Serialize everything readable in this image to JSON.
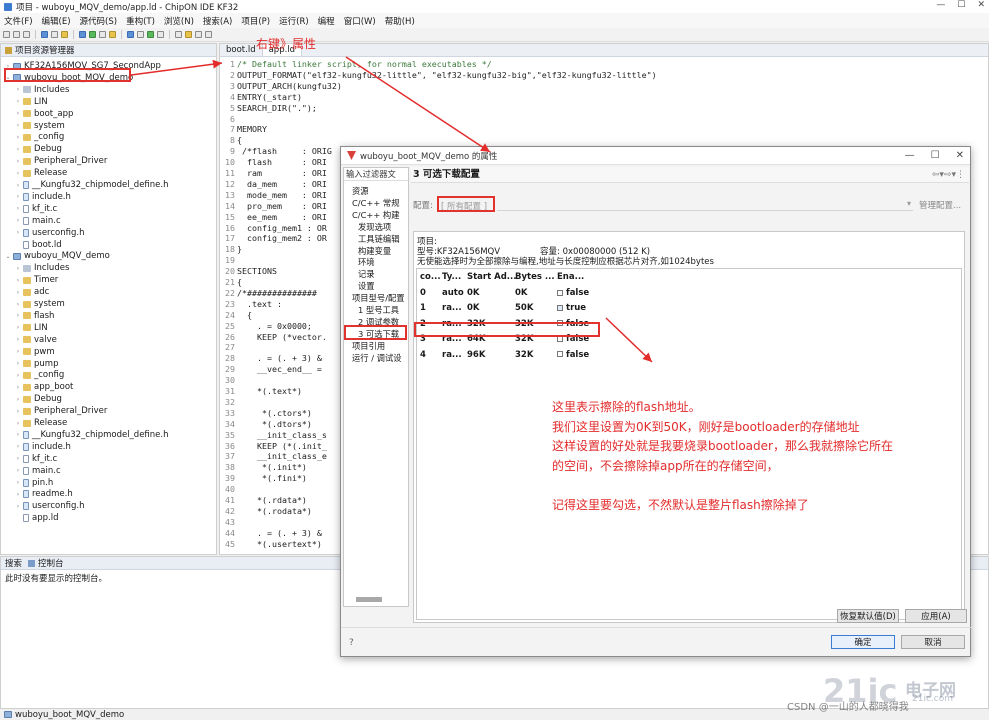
{
  "window": {
    "title": "项目 - wuboyu_MQV_demo/app.ld - ChipON IDE KF32",
    "min": "—",
    "max": "☐",
    "close": "✕"
  },
  "menu": [
    "文件(F)",
    "编辑(E)",
    "源代码(S)",
    "重构(T)",
    "浏览(N)",
    "搜索(A)",
    "项目(P)",
    "运行(R)",
    "编程",
    "窗口(W)",
    "帮助(H)"
  ],
  "explorer": {
    "title": "项目资源管理器",
    "rows": [
      {
        "label": "KF32A156MQV_SG7_SecondApp",
        "indent": 0,
        "type": "proj",
        "tri": "›"
      },
      {
        "label": "wuboyu_boot_MQV_demo",
        "indent": 0,
        "type": "proj",
        "tri": "⌄"
      },
      {
        "label": "Includes",
        "indent": 1,
        "type": "lib",
        "tri": "›"
      },
      {
        "label": "LIN",
        "indent": 1,
        "type": "folder",
        "tri": "›"
      },
      {
        "label": "boot_app",
        "indent": 1,
        "type": "folder",
        "tri": "›"
      },
      {
        "label": "system",
        "indent": 1,
        "type": "folder",
        "tri": "›"
      },
      {
        "label": "_config",
        "indent": 1,
        "type": "folder",
        "tri": "›"
      },
      {
        "label": "Debug",
        "indent": 1,
        "type": "folder",
        "tri": "›"
      },
      {
        "label": "Peripheral_Driver",
        "indent": 1,
        "type": "folder",
        "tri": "›"
      },
      {
        "label": "Release",
        "indent": 1,
        "type": "folder",
        "tri": "›"
      },
      {
        "label": "__Kungfu32_chipmodel_define.h",
        "indent": 1,
        "type": "hfile",
        "tri": "›"
      },
      {
        "label": "include.h",
        "indent": 1,
        "type": "hfile",
        "tri": "›"
      },
      {
        "label": "kf_it.c",
        "indent": 1,
        "type": "file",
        "tri": "›"
      },
      {
        "label": "main.c",
        "indent": 1,
        "type": "file",
        "tri": "›"
      },
      {
        "label": "userconfig.h",
        "indent": 1,
        "type": "hfile",
        "tri": "›"
      },
      {
        "label": "boot.ld",
        "indent": 1,
        "type": "file",
        "tri": ""
      },
      {
        "label": "wuboyu_MQV_demo",
        "indent": 0,
        "type": "proj",
        "tri": "⌄"
      },
      {
        "label": "Includes",
        "indent": 1,
        "type": "lib",
        "tri": "›"
      },
      {
        "label": "Timer",
        "indent": 1,
        "type": "folder",
        "tri": "›"
      },
      {
        "label": "adc",
        "indent": 1,
        "type": "folder",
        "tri": "›"
      },
      {
        "label": "system",
        "indent": 1,
        "type": "folder",
        "tri": "›"
      },
      {
        "label": "flash",
        "indent": 1,
        "type": "folder",
        "tri": "›"
      },
      {
        "label": "LIN",
        "indent": 1,
        "type": "folder",
        "tri": "›"
      },
      {
        "label": "valve",
        "indent": 1,
        "type": "folder",
        "tri": "›"
      },
      {
        "label": "pwm",
        "indent": 1,
        "type": "folder",
        "tri": "›"
      },
      {
        "label": "pump",
        "indent": 1,
        "type": "folder",
        "tri": "›"
      },
      {
        "label": "_config",
        "indent": 1,
        "type": "folder",
        "tri": "›"
      },
      {
        "label": "app_boot",
        "indent": 1,
        "type": "folder",
        "tri": "›"
      },
      {
        "label": "Debug",
        "indent": 1,
        "type": "folder",
        "tri": "›"
      },
      {
        "label": "Peripheral_Driver",
        "indent": 1,
        "type": "folder",
        "tri": "›"
      },
      {
        "label": "Release",
        "indent": 1,
        "type": "folder",
        "tri": "›"
      },
      {
        "label": "__Kungfu32_chipmodel_define.h",
        "indent": 1,
        "type": "hfile",
        "tri": "›"
      },
      {
        "label": "include.h",
        "indent": 1,
        "type": "hfile",
        "tri": "›"
      },
      {
        "label": "kf_it.c",
        "indent": 1,
        "type": "file",
        "tri": "›"
      },
      {
        "label": "main.c",
        "indent": 1,
        "type": "file",
        "tri": "›"
      },
      {
        "label": "pin.h",
        "indent": 1,
        "type": "hfile",
        "tri": "›"
      },
      {
        "label": "readme.h",
        "indent": 1,
        "type": "hfile",
        "tri": "›"
      },
      {
        "label": "userconfig.h",
        "indent": 1,
        "type": "hfile",
        "tri": "›"
      },
      {
        "label": "app.ld",
        "indent": 1,
        "type": "file",
        "tri": ""
      }
    ]
  },
  "editor": {
    "tabs": [
      "boot.ld",
      "app.ld"
    ],
    "lines": [
      {
        "n": "1",
        "t": "/* Default linker script, for normal executables */",
        "c": "cmt"
      },
      {
        "n": "2",
        "t": "OUTPUT_FORMAT(\"elf32-kungfu32-little\", \"elf32-kungfu32-big\",\"elf32-kungfu32-little\")",
        "c": ""
      },
      {
        "n": "3",
        "t": "OUTPUT_ARCH(kungfu32)",
        "c": ""
      },
      {
        "n": "4",
        "t": "ENTRY(_start)",
        "c": ""
      },
      {
        "n": "5",
        "t": "SEARCH_DIR(\".\");",
        "c": ""
      },
      {
        "n": "6",
        "t": "",
        "c": ""
      },
      {
        "n": "7",
        "t": "MEMORY",
        "c": ""
      },
      {
        "n": "8",
        "t": "{",
        "c": ""
      },
      {
        "n": "9",
        "t": " /*flash     : ORIG",
        "c": ""
      },
      {
        "n": "10",
        "t": "  flash      : ORI",
        "c": ""
      },
      {
        "n": "11",
        "t": "  ram        : ORI",
        "c": ""
      },
      {
        "n": "12",
        "t": "  da_mem     : ORI",
        "c": ""
      },
      {
        "n": "13",
        "t": "  mode_mem   : ORI",
        "c": ""
      },
      {
        "n": "14",
        "t": "  pro_mem    : ORI",
        "c": ""
      },
      {
        "n": "15",
        "t": "  ee_mem     : ORI",
        "c": ""
      },
      {
        "n": "16",
        "t": "  config_mem1 : OR",
        "c": ""
      },
      {
        "n": "17",
        "t": "  config_mem2 : OR",
        "c": ""
      },
      {
        "n": "18",
        "t": "}",
        "c": ""
      },
      {
        "n": "19",
        "t": "",
        "c": ""
      },
      {
        "n": "20",
        "t": "SECTIONS",
        "c": ""
      },
      {
        "n": "21",
        "t": "{",
        "c": ""
      },
      {
        "n": "22",
        "t": "/*##############",
        "c": ""
      },
      {
        "n": "23",
        "t": "  .text :",
        "c": ""
      },
      {
        "n": "24",
        "t": "  {",
        "c": ""
      },
      {
        "n": "25",
        "t": "    . = 0x0000;",
        "c": ""
      },
      {
        "n": "26",
        "t": "    KEEP (*vector.",
        "c": ""
      },
      {
        "n": "27",
        "t": "",
        "c": ""
      },
      {
        "n": "28",
        "t": "    . = (. + 3) &",
        "c": ""
      },
      {
        "n": "29",
        "t": "    __vec_end__ =",
        "c": ""
      },
      {
        "n": "30",
        "t": "",
        "c": ""
      },
      {
        "n": "31",
        "t": "    *(.text*)",
        "c": ""
      },
      {
        "n": "32",
        "t": "",
        "c": ""
      },
      {
        "n": "33",
        "t": "     *(.ctors*)",
        "c": ""
      },
      {
        "n": "34",
        "t": "     *(.dtors*)",
        "c": ""
      },
      {
        "n": "35",
        "t": "    __init_class_s",
        "c": ""
      },
      {
        "n": "36",
        "t": "    KEEP (*(.init_",
        "c": ""
      },
      {
        "n": "37",
        "t": "    __init_class_e",
        "c": ""
      },
      {
        "n": "38",
        "t": "     *(.init*)",
        "c": ""
      },
      {
        "n": "39",
        "t": "     *(.fini*)",
        "c": ""
      },
      {
        "n": "40",
        "t": "",
        "c": ""
      },
      {
        "n": "41",
        "t": "    *(.rdata*)",
        "c": ""
      },
      {
        "n": "42",
        "t": "    *(.rodata*)",
        "c": ""
      },
      {
        "n": "43",
        "t": "",
        "c": ""
      },
      {
        "n": "44",
        "t": "    . = (. + 3) &",
        "c": ""
      },
      {
        "n": "45",
        "t": "    *(.usertext*)",
        "c": ""
      }
    ]
  },
  "console": {
    "tabs": [
      "搜索",
      "控制台"
    ],
    "message": "此时没有要显示的控制台。"
  },
  "statusbar": {
    "text": "wuboyu_boot_MQV_demo"
  },
  "dialog": {
    "title": "wuboyu_boot_MQV_demo 的属性",
    "filter_placeholder": "输入过滤器文",
    "nav": [
      {
        "label": "资源",
        "indent": 0
      },
      {
        "label": "C/C++ 常规",
        "indent": 0
      },
      {
        "label": "C/C++ 构建",
        "indent": 0
      },
      {
        "label": "发现选项",
        "indent": 1
      },
      {
        "label": "工具链编辑",
        "indent": 1
      },
      {
        "label": "构建变量",
        "indent": 1
      },
      {
        "label": "环境",
        "indent": 1
      },
      {
        "label": "记录",
        "indent": 1
      },
      {
        "label": "设置",
        "indent": 1
      },
      {
        "label": "项目型号/配置",
        "indent": 0
      },
      {
        "label": "1 型号工具",
        "indent": 1
      },
      {
        "label": "2 调试参数",
        "indent": 1
      },
      {
        "label": "3 可选下载",
        "indent": 1
      },
      {
        "label": "项目引用",
        "indent": 0
      },
      {
        "label": "运行 / 调试设",
        "indent": 0
      }
    ],
    "section_title": "3 可选下载配置",
    "config_label": "配置:",
    "config_value": "[ 所有配置 ]",
    "manage_label": "管理配置...",
    "project_label": "项目:",
    "model_label": "型号:",
    "model_value": "KF32A156MQV",
    "capacity_label": "容量:",
    "capacity_value": "0x00080000 (512 K)",
    "note": "无使能选择时为全部擦除与编程,地址与长度控制应根据芯片对齐,如1024bytes",
    "columns": [
      "co...",
      "Ty...",
      "Start Ad...",
      "Bytes ...",
      "Ena..."
    ],
    "rows": [
      {
        "co": "0",
        "ty": "auto",
        "start": "0K",
        "bytes": "0K",
        "ena": "false"
      },
      {
        "co": "1",
        "ty": "ra...",
        "start": "0K",
        "bytes": "50K",
        "ena": "true"
      },
      {
        "co": "2",
        "ty": "ra...",
        "start": "32K",
        "bytes": "32K",
        "ena": "false"
      },
      {
        "co": "3",
        "ty": "ra...",
        "start": "64K",
        "bytes": "32K",
        "ena": "false"
      },
      {
        "co": "4",
        "ty": "ra...",
        "start": "96K",
        "bytes": "32K",
        "ena": "false"
      }
    ],
    "restore_label": "恢复默认值(D)",
    "apply_label": "应用(A)",
    "ok_label": "确定",
    "cancel_label": "取消",
    "help_glyph": "?"
  },
  "annotations": {
    "top": "右键》属性",
    "lines": [
      "这里表示擦除的flash地址。",
      "我们这里设置为0K到50K，刚好是bootloader的存储地址",
      "这样设置的好处就是我要烧录bootloader，那么我就擦除它所在",
      "的空间，不会擦除掉app所在的存储空间，",
      "",
      "记得这里要勾选，不然默认是整片flash擦除掉了"
    ]
  },
  "watermark": {
    "logo": "21ic",
    "cn": "电子网",
    "en": "21ic.com",
    "csdn": "CSDN @一山的人都晓得我"
  },
  "colors": {
    "annotation": "#e32c2c",
    "accent": "#3a7bd5"
  }
}
